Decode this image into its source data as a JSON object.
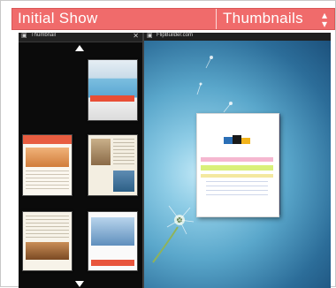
{
  "header": {
    "left_label": "Initial Show",
    "right_label": "Thumbnails"
  },
  "thumbnail_panel": {
    "title": "Thumbnail"
  },
  "viewer": {
    "title": "FlipBuilder.com"
  },
  "colors": {
    "header_bg": "#f06b6b",
    "panel_bg": "#0b0b0b",
    "viewer_bg": "#5aa7cb"
  },
  "icons": [
    "close-icon",
    "arrow-up-icon",
    "arrow-down-icon",
    "chevron-updown-icon"
  ]
}
